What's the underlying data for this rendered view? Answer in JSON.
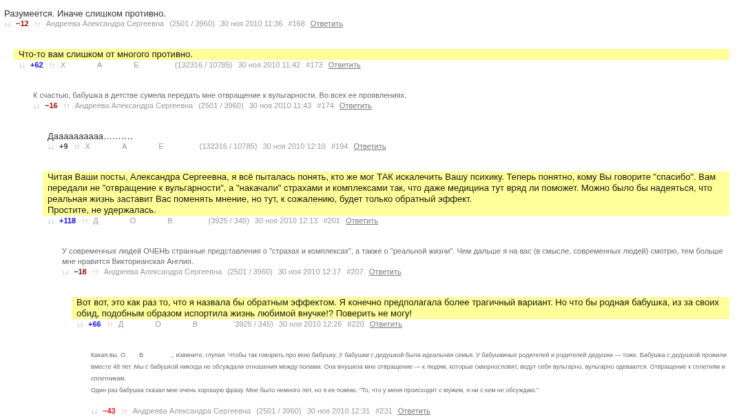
{
  "comments": [
    {
      "kind": "plain",
      "paragraphs": [
        "Разумеется. Иначе слишком противно."
      ],
      "down": "↓↓",
      "rating": "−12",
      "color": "#aa1111",
      "up": "↑↑",
      "author": [
        "Андреева Александра Сергеевна"
      ],
      "stats": "(2501 / 3960)",
      "date": "30 ноя 2010 11:36",
      "number": "#168",
      "reply": "Ответить",
      "children": [
        {
          "kind": "highlight",
          "paragraphs": [
            "Что-то вам слишком от многого противно."
          ],
          "down": "↓↓",
          "rating": "+62",
          "color": "#1111ee",
          "up": "↑↑",
          "author": [
            "Х",
            "А",
            "Е"
          ],
          "stats": "(132316 / 10785)",
          "date": "30 ноя 2010 11:42",
          "number": "#173",
          "reply": "Ответить",
          "children": [
            {
              "kind": "faded",
              "paragraphs": [
                "К счастью, бабушка в детстве сумела передать мне отвращение к вульгарности. Во всех ее проявлениях."
              ],
              "down": "↓↓",
              "rating": "−16",
              "color": "#aa1111",
              "up": "↑↑",
              "author": [
                "Андреева Александра Сергеевна"
              ],
              "stats": "(2501 / 3960)",
              "date": "30 ноя 2010 11:43",
              "number": "#174",
              "reply": "Ответить",
              "children": [
                {
                  "kind": "plain",
                  "paragraphs": [
                    "Даааааааааа………."
                  ],
                  "down": "↓↓",
                  "rating": "+9",
                  "color": "#444444",
                  "up": "↑↑",
                  "author": [
                    "Х",
                    "А",
                    "Е"
                  ],
                  "stats": "(132316 / 10785)",
                  "date": "30 ноя 2010 12:10",
                  "number": "#194",
                  "reply": "Ответить"
                },
                {
                  "kind": "highlight",
                  "paragraphs": [
                    "Читая Ваши посты, Александра Сергеевна, я всё пыталась понять, кто же мог ТАК искалечить Вашу психику. Теперь понятно, кому Вы говорите \"спасибо\". Вам передали не \"отвращение к вульгарности\", а \"накачали\" страхами и комплексами так, что даже медицина тут вряд ли поможет. Можно было бы надеяться, что реальная жизнь заставит Вас поменять мнение, но тут, к сожалению, будет только обратный эффект.",
                    "Простите, не удержалась."
                  ],
                  "down": "↓↓",
                  "rating": "+118",
                  "color": "#1111ee",
                  "up": "↑↑",
                  "author": [
                    "Д",
                    "О",
                    "В"
                  ],
                  "stats": "(3925 / 345)",
                  "date": "30 ноя 2010 12:13",
                  "number": "#201",
                  "reply": "Ответить",
                  "children": [
                    {
                      "kind": "faded",
                      "paragraphs": [
                        "У современных людей ОЧЕНЬ странные представления о \"страхах и комплексах\", а также о \"реальной жизни\". Чем дальше я на вас (в смысле, современных людей) смотрю, тем больше мне нравится Викторианская Англия."
                      ],
                      "down": "↓↓",
                      "rating": "−18",
                      "color": "#aa1111",
                      "up": "↑↑",
                      "author": [
                        "Андреева Александра Сергеевна"
                      ],
                      "stats": "(2501 / 3960)",
                      "date": "30 ноя 2010 12:17",
                      "number": "#207",
                      "reply": "Ответить",
                      "children": [
                        {
                          "kind": "highlight",
                          "paragraphs": [
                            "Вот вот, это как раз то, что я назвала бы обратным эффектом. Я конечно предполагала более трагичный вариант. Но что бы родная бабушка, из за своих обид, подобным образом испортила жизнь любимой внучке!? Поверить не могу!"
                          ],
                          "down": "↓↓",
                          "rating": "+66",
                          "color": "#1111ee",
                          "up": "↑↑",
                          "author": [
                            "Д",
                            "О",
                            "В"
                          ],
                          "stats": "'3925 / 345)",
                          "date": "30 ноя 2010 12:26",
                          "number": "#220",
                          "reply": "Ответить",
                          "children": [
                            {
                              "kind": "tiny",
                              "paragraphs": [
                                "Какая вы, О.       В                ., извините, глупая. Чтобы так говорить про мою бабушку. У бабушки с дедушкой была идеальная семья. У бабушкиных родителей и родителей дедушки — тоже. Бабушка с дедушкой прожили вместе 48 лет. Мы с бабушкой никогда не обсуждали отношения между полами. Она внушила мне отвращение — к людям, которые сквернословят, ведут себя вульгарно, вульгарно одеваются. Отвращение к сплетням и сплетникам.",
                                "Один раз бабушка сказал мне очень хорошую фразу. Мне было немного лет, но я ее помню. \"То, что у меня происходит с мужем, я ни с кем не обсуждаю.\""
                              ],
                              "down": "↓↓",
                              "rating": "−43",
                              "color": "#ee1111",
                              "up": "↑↑",
                              "author": [
                                "Андреева Александра Сергеевна"
                              ],
                              "stats": "(2501 / 3960)",
                              "date": "30 ноя 2010 12:31",
                              "number": "#231",
                              "reply": "Ответить"
                            }
                          ]
                        }
                      ]
                    }
                  ]
                }
              ]
            }
          ]
        }
      ]
    }
  ]
}
